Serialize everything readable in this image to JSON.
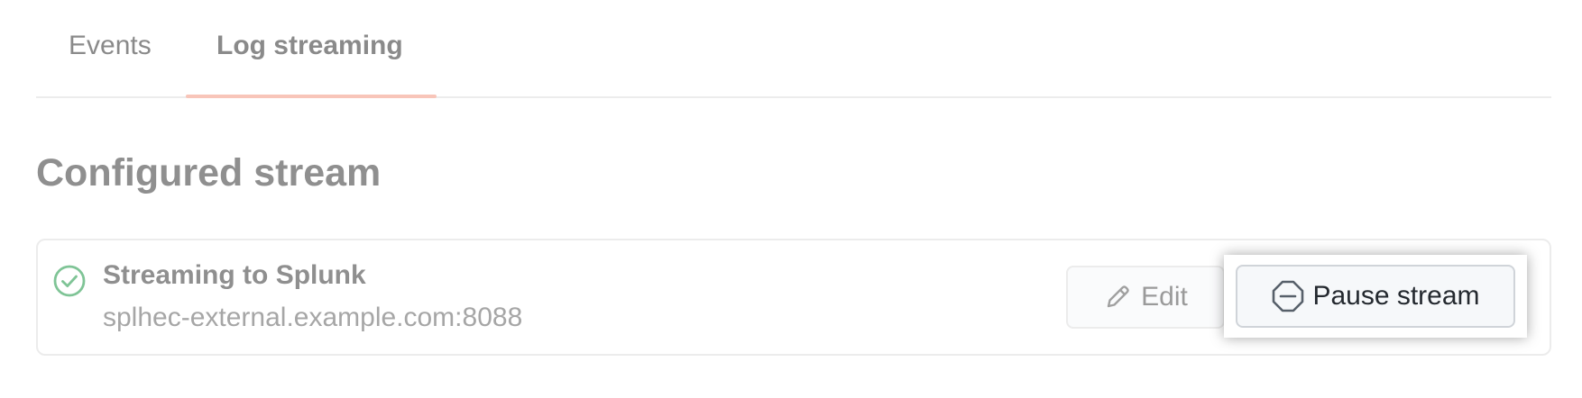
{
  "tabs": [
    {
      "label": "Events",
      "active": false
    },
    {
      "label": "Log streaming",
      "active": true
    }
  ],
  "section": {
    "title": "Configured stream"
  },
  "stream": {
    "status_icon": "check-circle-icon",
    "name": "Streaming to Splunk",
    "host": "splhec-external.example.com:8088"
  },
  "actions": {
    "edit_label": "Edit",
    "edit_icon": "pencil-icon",
    "pause_label": "Pause stream",
    "pause_icon": "stop-icon"
  },
  "colors": {
    "tab_accent": "#f8c5b9",
    "success": "#3fa65a",
    "border": "#ececec",
    "text_primary": "#24292f",
    "text_muted": "#8f8f8f"
  }
}
